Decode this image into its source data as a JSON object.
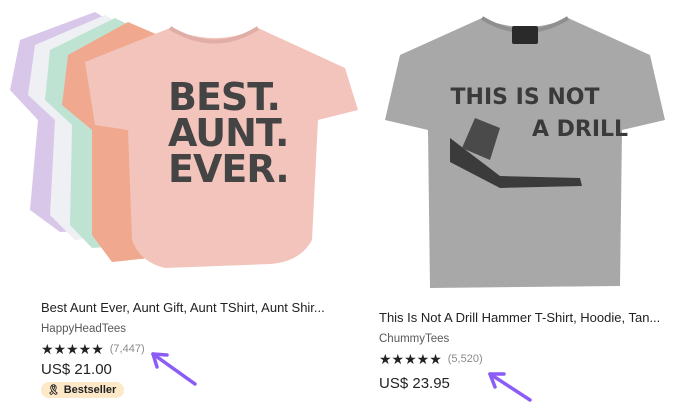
{
  "products": [
    {
      "image_text": [
        "BEST.",
        "AUNT.",
        "EVER."
      ],
      "title": "Best Aunt Ever, Aunt Gift, Aunt TShirt, Aunt Shir...",
      "shop": "HappyHeadTees",
      "stars": "★★★★★",
      "rating_value": 5,
      "review_count": "(7,447)",
      "price": "US$ 21.00",
      "badge": "Bestseller",
      "badge_icon": "ribbon-icon"
    },
    {
      "image_text": [
        "THIS IS NOT",
        "A DRILL"
      ],
      "title": "This Is Not A Drill Hammer T-Shirt, Hoodie, Tan...",
      "shop": "ChummyTees",
      "stars": "★★★★★",
      "rating_value": 5,
      "review_count": "(5,520)",
      "price": "US$ 23.95"
    }
  ],
  "colors": {
    "accent_arrow": "#8b5cf6",
    "badge_bg": "#fde8c8",
    "shirt_pink": "#f2c4bc",
    "shirt_gray": "#a8a8a8"
  }
}
